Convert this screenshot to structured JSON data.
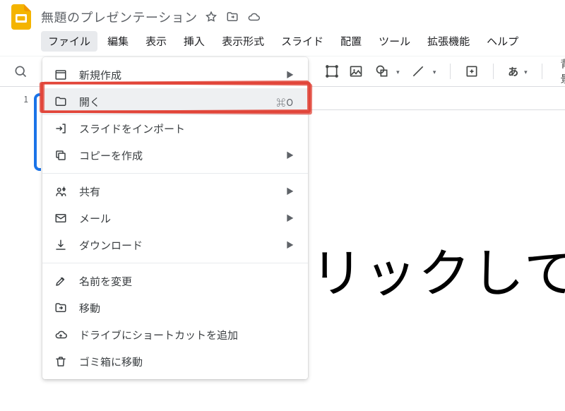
{
  "app": {
    "title": "無題のプレゼンテーション"
  },
  "menubar": [
    "ファイル",
    "編集",
    "表示",
    "挿入",
    "表示形式",
    "スライド",
    "配置",
    "ツール",
    "拡張機能",
    "ヘルプ"
  ],
  "menubar_active_index": 0,
  "toolbar": {
    "text_format_label": "あ",
    "background_label": "背景"
  },
  "file_menu": {
    "items": [
      {
        "icon": "window-icon",
        "label": "新規作成",
        "submenu": true
      },
      {
        "icon": "folder-icon",
        "label": "開く",
        "shortcut": "⌘O",
        "highlighted": true
      },
      {
        "icon": "import-icon",
        "label": "スライドをインポート"
      },
      {
        "icon": "copy-icon",
        "label": "コピーを作成",
        "submenu": true
      },
      {
        "sep": true
      },
      {
        "icon": "share-icon",
        "label": "共有",
        "submenu": true
      },
      {
        "icon": "mail-icon",
        "label": "メール",
        "submenu": true
      },
      {
        "icon": "download-icon",
        "label": "ダウンロード",
        "submenu": true
      },
      {
        "sep": true
      },
      {
        "icon": "rename-icon",
        "label": "名前を変更"
      },
      {
        "icon": "move-icon",
        "label": "移動"
      },
      {
        "icon": "shortcut-icon",
        "label": "ドライブにショートカットを追加"
      },
      {
        "icon": "trash-icon",
        "label": "ゴミ箱に移動"
      }
    ]
  },
  "slidelist": {
    "current": "1"
  },
  "canvas": {
    "prompt_fragment": "リックして"
  }
}
